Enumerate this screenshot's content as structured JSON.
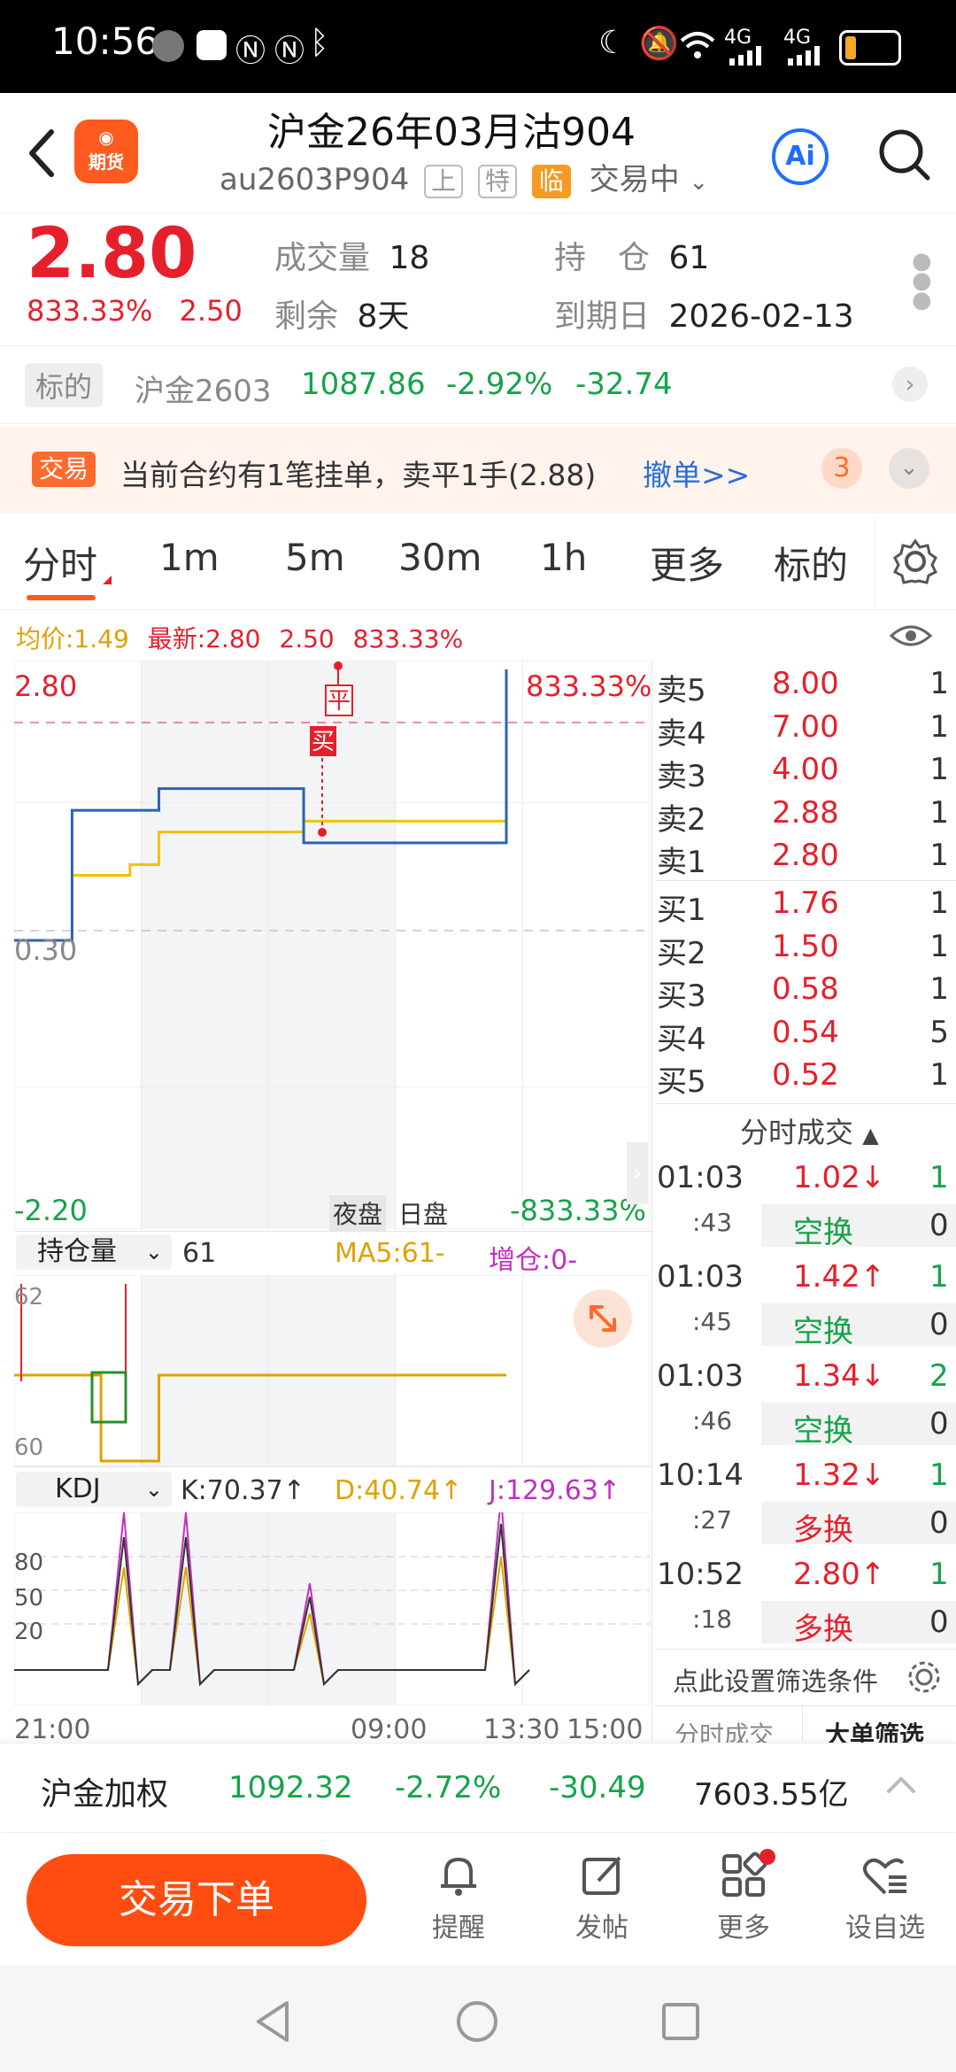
{
  "status": {
    "time": "10:56",
    "net1": "4G",
    "net2": "4G"
  },
  "header": {
    "title": "沪金26年03月沽904",
    "code": "au2603P904",
    "tags": [
      "上",
      "特",
      "临"
    ],
    "state": "交易中",
    "logo_text": "期货",
    "ai_label": "Ai"
  },
  "quote": {
    "price": "2.80",
    "pct": "833.33%",
    "chg": "2.50",
    "vol_label": "成交量",
    "vol": "18",
    "oi_label": "持　仓",
    "oi": "61",
    "remain_label": "剩余",
    "remain": "8天",
    "expire_label": "到期日",
    "expire": "2026-02-13"
  },
  "underlying": {
    "label": "标的",
    "name": "沪金2603",
    "price": "1087.86",
    "pct": "-2.92%",
    "chg": "-32.74"
  },
  "notice": {
    "tag": "交易",
    "text": "当前合约有1笔挂单，卖平1手(2.88)",
    "link": "撤单>>",
    "count": "3"
  },
  "tabs": [
    "分时",
    "1m",
    "5m",
    "30m",
    "1h",
    "更多",
    "标的"
  ],
  "info_bar": {
    "avg": "均价:1.49",
    "last": "最新:2.80",
    "chg": "2.50",
    "pct": "833.33%"
  },
  "chart_data": [
    {
      "type": "line",
      "title": "",
      "y_labels": {
        "top": "2.80",
        "mid": "0.30",
        "bottom": "-2.20",
        "top_pct": "833.33%",
        "bottom_pct": "-833.33%"
      },
      "session_labels": [
        "夜盘",
        "日盘"
      ],
      "ylim": [
        -2.2,
        2.8
      ],
      "markers": [
        "平",
        "买"
      ],
      "series": [
        {
          "name": "最新",
          "color": "#2a62b8",
          "values": [
            0.3,
            0.3,
            1.5,
            1.5,
            1.5,
            1.7,
            1.7,
            1.7,
            1.7,
            1.7,
            1.2,
            1.2,
            1.2,
            1.2,
            1.2,
            1.2,
            1.2,
            2.8
          ]
        },
        {
          "name": "均价",
          "color": "#f2c200",
          "values": [
            0.3,
            0.3,
            0.9,
            0.9,
            1.0,
            1.3,
            1.3,
            1.3,
            1.3,
            1.3,
            1.4,
            1.4,
            1.4,
            1.4,
            1.4,
            1.4,
            1.4,
            1.49
          ]
        }
      ]
    },
    {
      "type": "line",
      "title": "持仓量",
      "legend": {
        "value": "61",
        "ma5": "MA5:61-",
        "delta": "增仓:0-"
      },
      "y_labels": {
        "top": "62",
        "bottom": "60"
      },
      "ylim": [
        60,
        62
      ],
      "series": [
        {
          "name": "持仓量",
          "color": "#e0a100",
          "values": [
            61,
            61,
            61,
            60,
            60,
            61,
            61,
            61,
            61,
            61,
            61,
            61,
            61,
            61,
            61,
            61,
            61,
            61
          ]
        }
      ]
    },
    {
      "type": "line",
      "title": "KDJ",
      "legend": {
        "k": "K:70.37↑",
        "d": "D:40.74↑",
        "j": "J:129.63↑"
      },
      "y_ticks": [
        "80",
        "50",
        "20"
      ],
      "x_labels": [
        "21:00",
        "09:00",
        "13:30",
        "15:00"
      ]
    }
  ],
  "orderbook": {
    "asks": [
      {
        "label": "卖5",
        "price": "8.00",
        "vol": "1"
      },
      {
        "label": "卖4",
        "price": "7.00",
        "vol": "1"
      },
      {
        "label": "卖3",
        "price": "4.00",
        "vol": "1"
      },
      {
        "label": "卖2",
        "price": "2.88",
        "vol": "1"
      },
      {
        "label": "卖1",
        "price": "2.80",
        "vol": "1"
      }
    ],
    "bids": [
      {
        "label": "买1",
        "price": "1.76",
        "vol": "1"
      },
      {
        "label": "买2",
        "price": "1.50",
        "vol": "1"
      },
      {
        "label": "买3",
        "price": "0.58",
        "vol": "1"
      },
      {
        "label": "买4",
        "price": "0.54",
        "vol": "5"
      },
      {
        "label": "买5",
        "price": "0.52",
        "vol": "1"
      }
    ]
  },
  "ticks": {
    "header": "分时成交",
    "rows": [
      {
        "time": "01:03",
        "sec": ":43",
        "price": "1.02↓",
        "vol": "1",
        "type": "空换",
        "tvol": "0",
        "up": false
      },
      {
        "time": "01:03",
        "sec": ":45",
        "price": "1.42↑",
        "vol": "1",
        "type": "空换",
        "tvol": "0",
        "up": true
      },
      {
        "time": "01:03",
        "sec": ":46",
        "price": "1.34↓",
        "vol": "2",
        "type": "空换",
        "tvol": "0",
        "up": false
      },
      {
        "time": "10:14",
        "sec": ":27",
        "price": "1.32↓",
        "vol": "1",
        "type": "多换",
        "tvol": "0",
        "up": false
      },
      {
        "time": "10:52",
        "sec": ":18",
        "price": "2.80↑",
        "vol": "1",
        "type": "多换",
        "tvol": "0",
        "up": true
      }
    ],
    "filter": "点此设置筛选条件",
    "tab1": "分时成交",
    "tab2": "大单筛选"
  },
  "index_bar": {
    "name": "沪金加权",
    "price": "1092.32",
    "pct": "-2.72%",
    "chg": "-30.49",
    "amount": "7603.55亿"
  },
  "bottom": {
    "trade": "交易下单",
    "remind": "提醒",
    "post": "发帖",
    "more": "更多",
    "watch": "设自选"
  }
}
